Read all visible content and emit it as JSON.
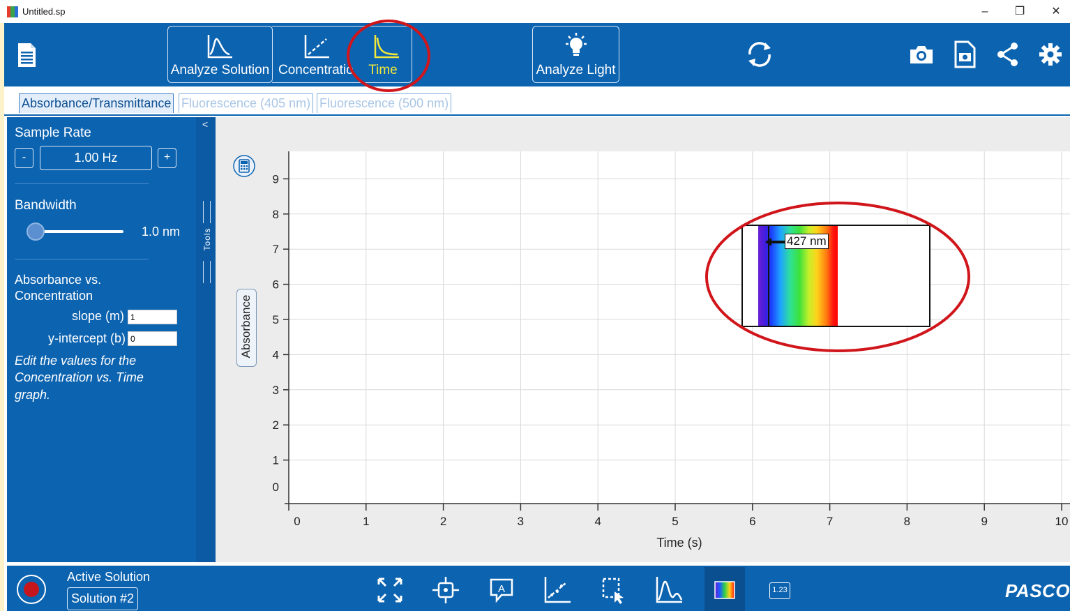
{
  "window": {
    "title": "Untitled.sp",
    "controls": [
      "–",
      "❐",
      "✕"
    ]
  },
  "toolbar": {
    "analyze_solution": "Analyze Solution",
    "concentration": "Concentratio",
    "time": "Time",
    "analyze_light": "Analyze Light"
  },
  "tabs": [
    "Absorbance/Transmittance",
    "Fluorescence (405 nm)",
    "Fluorescence (500 nm)"
  ],
  "sidebar": {
    "collapse": "<",
    "tools_label": "Tools",
    "sample_rate": {
      "label": "Sample Rate",
      "minus": "-",
      "value": "1.00 Hz",
      "plus": "+"
    },
    "bandwidth": {
      "label": "Bandwidth",
      "value": "1.0 nm",
      "slider_level": 0
    },
    "model": {
      "title_line1": "Absorbance vs.",
      "title_line2": "Concentration",
      "slope_label": "slope (m)",
      "slope_value": "1",
      "intercept_label": "y-intercept (b)",
      "intercept_value": "0",
      "hint_line1": "Edit the values for the",
      "hint_line2": "Concentration vs. Time",
      "hint_line3": "graph."
    }
  },
  "chart_data": {
    "type": "line",
    "xlabel": "Time (s)",
    "ylabel": "Absorbance",
    "xlim": [
      0,
      10
    ],
    "ylim": [
      0,
      10
    ],
    "x_ticks": [
      "0",
      "1",
      "2",
      "3",
      "4",
      "5",
      "6",
      "7",
      "8",
      "9",
      "10"
    ],
    "y_ticks": [
      "0",
      "1",
      "2",
      "3",
      "4",
      "5",
      "6",
      "7",
      "8",
      "9"
    ],
    "series": [],
    "grid": true
  },
  "wavelength_selector": {
    "label": "427 nm"
  },
  "annotations": {
    "circle_color": "#d0151b"
  },
  "bottombar": {
    "active_label": "Active Solution",
    "solution": "Solution #2",
    "brand": "PASCO",
    "digits_icon_text": "1.23"
  },
  "colors": {
    "brand_blue": "#0c63b0",
    "time_yellow": "#f3e83a",
    "record_red": "#c4161c"
  }
}
